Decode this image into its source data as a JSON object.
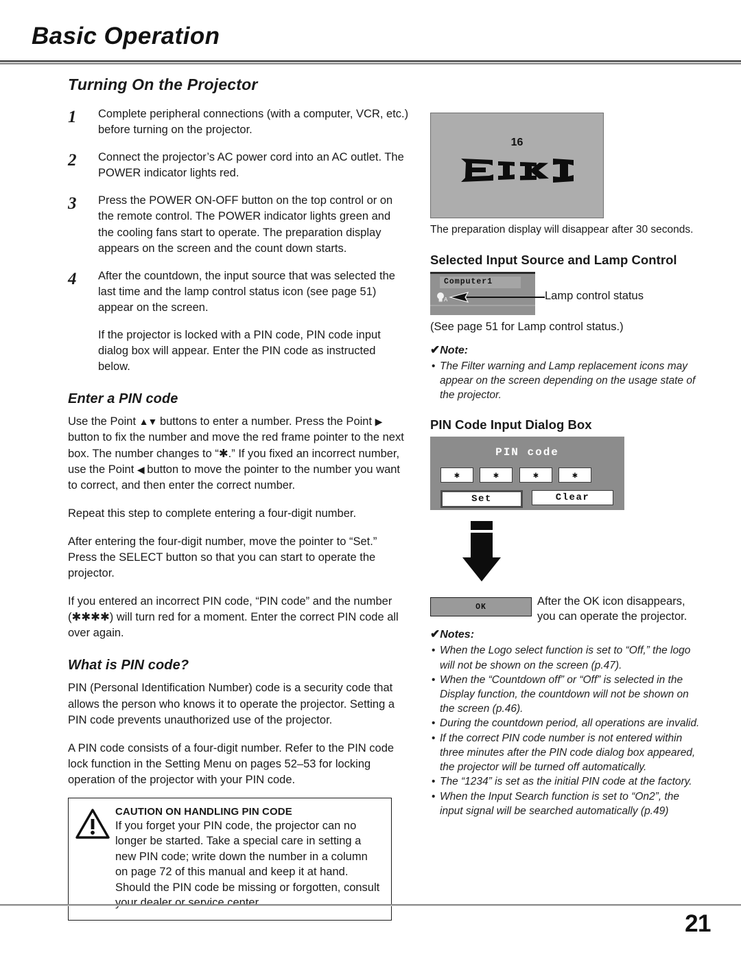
{
  "header": {
    "title": "Basic Operation"
  },
  "left": {
    "section_title": "Turning On the Projector",
    "steps": [
      {
        "num": "1",
        "text": "Complete peripheral connections (with a computer, VCR, etc.) before turning on the projector."
      },
      {
        "num": "2",
        "text": "Connect the projector’s AC power cord into an AC outlet. The POWER indicator lights red."
      },
      {
        "num": "3",
        "text": "Press the POWER ON-OFF button on the top control or on the remote control. The POWER indicator lights green and the cooling fans start to operate. The preparation display appears on the screen and the count down starts."
      },
      {
        "num": "4",
        "text": "After the countdown, the input source that was selected the last time and the lamp control status icon (see page 51) appear on the screen."
      }
    ],
    "step4_followup": "If the projector is locked with a PIN code, PIN code input dialog box will appear. Enter the PIN code as instructed below.",
    "enter_pin_title": "Enter a PIN code",
    "enter_pin_p1_a": "Use the Point ",
    "enter_pin_p1_updown": "▲▼",
    "enter_pin_p1_b": " buttons to enter a number. Press the Point ",
    "enter_pin_p1_right": "▶",
    "enter_pin_p1_c": " button to fix the number and move the red frame pointer to the next box. The number changes to “✱.” If you fixed an incorrect number, use the Point ",
    "enter_pin_p1_left": "◀",
    "enter_pin_p1_d": " button to move the pointer to the number you want to correct, and then enter the correct number.",
    "enter_pin_p2": "Repeat this step to complete entering a four-digit number.",
    "enter_pin_p3": "After entering the four-digit number, move the pointer to “Set.” Press the SELECT button so that you can start to operate the projector.",
    "enter_pin_p4": "If you entered an incorrect PIN code, “PIN code” and the number (✱✱✱✱) will turn red for a moment. Enter the correct PIN code all over again.",
    "what_is_pin_title": "What is PIN code?",
    "what_is_pin_p1": "PIN (Personal Identification Number) code is a security code that allows the person who knows it to operate the projector. Setting a PIN code prevents unauthorized use of the projector.",
    "what_is_pin_p2": "A PIN code consists of a four-digit number. Refer to the PIN code lock function in the Setting Menu on pages 52–53 for locking operation of the projector with your PIN code.",
    "caution": {
      "heading": "CAUTION ON HANDLING PIN CODE",
      "body": "If you forget your PIN code, the projector can no longer be started. Take a special care in setting a new PIN code; write down the number in a column on page 72 of this manual and keep it at hand. Should the PIN code be missing or forgotten, consult your dealer or service center."
    }
  },
  "right": {
    "logo_shot": {
      "countdown": "16",
      "logo_text": "EIKI"
    },
    "logo_caption": "The preparation display will disappear after 30 seconds.",
    "input_source_heading": "Selected Input Source and Lamp Control",
    "source_label": "Computer1",
    "lamp_icon_letter": "A",
    "lamp_callout": "Lamp control status",
    "see_page_note": "(See page 51 for Lamp control status.)",
    "note_single": {
      "heading": "Note:",
      "items": [
        "The Filter warning and Lamp replacement icons may appear on the screen depending on the usage state of the projector."
      ]
    },
    "pin_dialog_heading": "PIN Code Input Dialog Box",
    "pin_dialog": {
      "title": "PIN code",
      "digits": [
        "✱",
        "✱",
        "✱",
        "✱"
      ],
      "set_label": "Set",
      "clear_label": "Clear"
    },
    "ok_chip_label": "OK",
    "ok_caption": "After the OK icon disappears, you can operate the projector.",
    "notes": {
      "heading": "Notes:",
      "items": [
        "When the Logo select function is set to “Off,” the logo will not be shown on the screen (p.47).",
        "When the “Countdown off” or “Off” is selected in the Display function, the countdown will not be shown on the screen (p.46).",
        "During the countdown period, all operations are invalid.",
        "If the correct PIN code number is not entered within three minutes after the PIN code dialog box appeared, the projector will be turned off automatically.",
        "The “1234” is set as the initial PIN code at the factory.",
        "When the Input Search function is set to “On2”, the input signal will be searched automatically (p.49)"
      ]
    }
  },
  "footer": {
    "page_number": "21"
  }
}
